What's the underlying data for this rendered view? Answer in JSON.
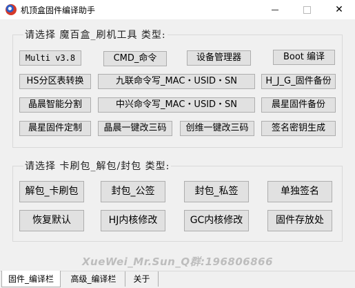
{
  "window": {
    "title": "机顶盒固件编译助手",
    "minimize_glyph": "—",
    "close_glyph": "✕"
  },
  "flash_group": {
    "legend": "请选择 魔百盒_刷机工具 类型:",
    "buttons": [
      "Multi v3.8",
      "CMD_命令",
      "设备管理器",
      "Boot 编译",
      "HS分区表转换",
      "九联命令写_MAC・USID・SN",
      "H_J_G_固件备份",
      "晶晨智能分割",
      "中兴命令写_MAC・USID・SN",
      "晨星固件备份",
      "晨星固件定制",
      "晶晨一键改三码",
      "创维一键改三码",
      "签名密钥生成"
    ]
  },
  "pack_group": {
    "legend": "请选择 卡刷包_解包/封包 类型:",
    "buttons": [
      "解包_卡刷包",
      "封包_公签",
      "封包_私签",
      "单独签名",
      "恢复默认",
      "HJ内核修改",
      "GC内核修改",
      "固件存放处"
    ]
  },
  "watermark": "XueWei_Mr.Sun_Q群:196806866",
  "tabs": [
    "固件_编译栏",
    "高级_编译栏",
    "关于"
  ],
  "active_tab": 0
}
